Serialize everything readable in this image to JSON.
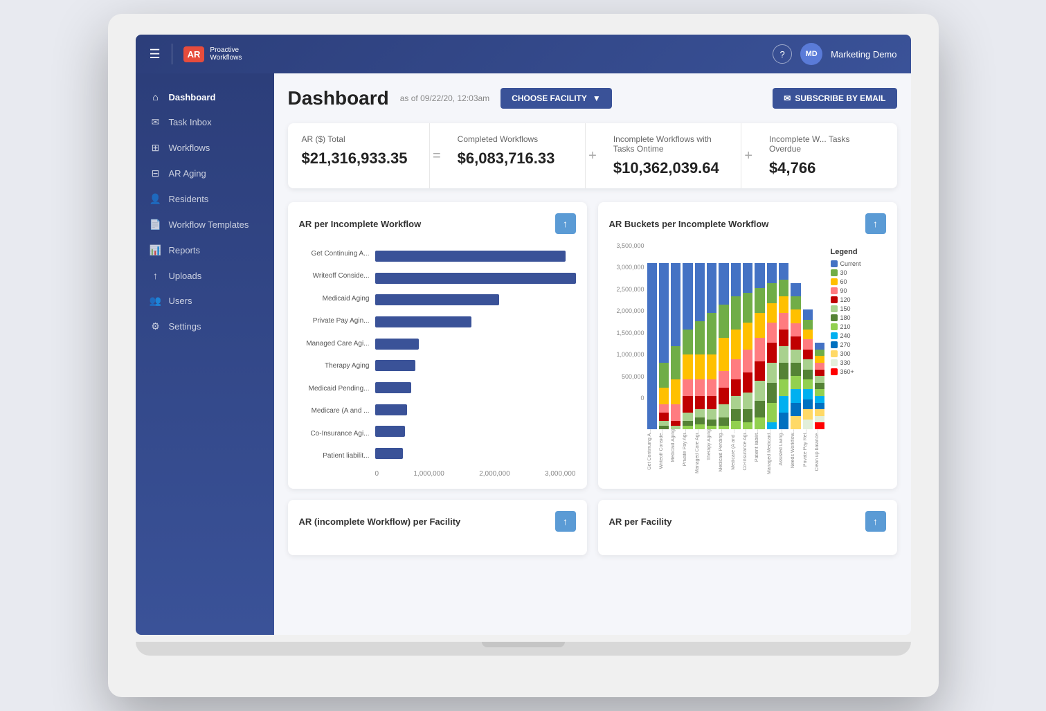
{
  "nav": {
    "logo_badge": "AR",
    "logo_name": "Proactive",
    "logo_sub": "Workflows",
    "hamburger": "☰",
    "help": "?",
    "user_initials": "MD",
    "user_name": "Marketing Demo"
  },
  "sidebar": {
    "items": [
      {
        "id": "dashboard",
        "label": "Dashboard",
        "icon": "⌂",
        "active": true
      },
      {
        "id": "task-inbox",
        "label": "Task Inbox",
        "icon": "✉"
      },
      {
        "id": "workflows",
        "label": "Workflows",
        "icon": "⊞"
      },
      {
        "id": "ar-aging",
        "label": "AR Aging",
        "icon": "⊟"
      },
      {
        "id": "residents",
        "label": "Residents",
        "icon": "👤"
      },
      {
        "id": "workflow-templates",
        "label": "Workflow Templates",
        "icon": "📄"
      },
      {
        "id": "reports",
        "label": "Reports",
        "icon": "📊"
      },
      {
        "id": "uploads",
        "label": "Uploads",
        "icon": "↑"
      },
      {
        "id": "users",
        "label": "Users",
        "icon": "👥"
      },
      {
        "id": "settings",
        "label": "Settings",
        "icon": "⚙"
      }
    ]
  },
  "dashboard": {
    "title": "Dashboard",
    "as_of": "as of 09/22/20, 12:03am",
    "choose_facility_label": "CHOOSE FACILITY",
    "subscribe_label": "SUBSCRIBE BY EMAIL",
    "stats": [
      {
        "label": "AR ($) Total",
        "value": "$21,316,933.35",
        "sep": "="
      },
      {
        "label": "Completed Workflows",
        "value": "$6,083,716.33",
        "sep": "+"
      },
      {
        "label": "Incomplete Workflows with Tasks Ontime",
        "value": "$10,362,039.64",
        "sep": "+"
      },
      {
        "label": "Incomplete W... Tasks Overdue",
        "value": "$4,766"
      }
    ],
    "chart1": {
      "title": "AR per Incomplete Workflow",
      "bars": [
        {
          "label": "Get Continuing A...",
          "pct": 95
        },
        {
          "label": "Writeoff Conside...",
          "pct": 100
        },
        {
          "label": "Medicaid Aging",
          "pct": 62
        },
        {
          "label": "Private Pay Agin...",
          "pct": 48
        },
        {
          "label": "Managed Care Agi...",
          "pct": 22
        },
        {
          "label": "Therapy Aging",
          "pct": 20
        },
        {
          "label": "Medicaid Pending...",
          "pct": 18
        },
        {
          "label": "Medicare (A and ...",
          "pct": 16
        },
        {
          "label": "Co-Insurance Agi...",
          "pct": 15
        },
        {
          "label": "Patient liabilit...",
          "pct": 14
        }
      ],
      "axis_labels": [
        "0",
        "1,000,000",
        "2,000,000",
        "3,000,000"
      ]
    },
    "chart2": {
      "title": "AR Buckets per Incomplete Workflow",
      "legend_title": "Legend",
      "legend_items": [
        {
          "label": "Current",
          "color": "#4472c4"
        },
        {
          "label": "30",
          "color": "#70ad47"
        },
        {
          "label": "60",
          "color": "#ffc000"
        },
        {
          "label": "90",
          "color": "#ff7c80"
        },
        {
          "label": "120",
          "color": "#c00000"
        },
        {
          "label": "150",
          "color": "#a9d18e"
        },
        {
          "label": "180",
          "color": "#548235"
        },
        {
          "label": "210",
          "color": "#92d050"
        },
        {
          "label": "240",
          "color": "#00b0f0"
        },
        {
          "label": "270",
          "color": "#0070c0"
        },
        {
          "label": "300",
          "color": "#ffd966"
        },
        {
          "label": "330",
          "color": "#e2efda"
        },
        {
          "label": "360+",
          "color": "#ff0000"
        }
      ],
      "y_labels": [
        "3,500,000",
        "3,000,000",
        "2,500,000",
        "2,000,000",
        "1,500,000",
        "1,000,000",
        "500,000",
        "0"
      ],
      "x_labels": [
        "Get Continuing A...",
        "Writeoff Conside...",
        "Medicaid Aging",
        "Private Pay Agi...",
        "Managed Care Agi...",
        "Therapy Aging",
        "Medicaid Pending...",
        "Medicare (A and ...",
        "Co-Insurance Agi...",
        "Patient liabilit...",
        "Managed Medicaid...",
        "Assisted Living...",
        "Needs Workflow...",
        "Private Pay Rel...",
        "Clean up balance..."
      ],
      "columns": [
        [
          100,
          0,
          0,
          0,
          0,
          0,
          0,
          0,
          0,
          0,
          0,
          0,
          0
        ],
        [
          60,
          15,
          10,
          5,
          5,
          3,
          2,
          0,
          0,
          0,
          0,
          0,
          0
        ],
        [
          50,
          20,
          15,
          10,
          3,
          2,
          0,
          0,
          0,
          0,
          0,
          0,
          0
        ],
        [
          40,
          15,
          15,
          10,
          10,
          5,
          3,
          2,
          0,
          0,
          0,
          0,
          0
        ],
        [
          35,
          20,
          15,
          10,
          8,
          5,
          4,
          3,
          0,
          0,
          0,
          0,
          0
        ],
        [
          30,
          25,
          15,
          10,
          8,
          6,
          4,
          2,
          0,
          0,
          0,
          0,
          0
        ],
        [
          25,
          20,
          20,
          10,
          10,
          8,
          5,
          2,
          0,
          0,
          0,
          0,
          0
        ],
        [
          20,
          20,
          18,
          12,
          10,
          8,
          7,
          5,
          0,
          0,
          0,
          0,
          0
        ],
        [
          18,
          18,
          16,
          14,
          12,
          10,
          8,
          4,
          0,
          0,
          0,
          0,
          0
        ],
        [
          15,
          15,
          15,
          14,
          12,
          12,
          10,
          7,
          0,
          0,
          0,
          0,
          0
        ],
        [
          12,
          12,
          12,
          12,
          12,
          12,
          12,
          12,
          4,
          0,
          0,
          0,
          0
        ],
        [
          10,
          10,
          10,
          10,
          10,
          10,
          10,
          10,
          10,
          10,
          0,
          0,
          0
        ],
        [
          8,
          8,
          8,
          8,
          8,
          8,
          8,
          8,
          8,
          8,
          8,
          0,
          0
        ],
        [
          6,
          6,
          6,
          6,
          6,
          6,
          6,
          6,
          6,
          6,
          6,
          6,
          0
        ],
        [
          4,
          4,
          4,
          4,
          4,
          4,
          4,
          4,
          4,
          4,
          4,
          4,
          4
        ]
      ]
    },
    "bottom_charts": [
      {
        "title": "AR (incomplete Workflow) per Facility"
      },
      {
        "title": "AR per Facility"
      }
    ]
  }
}
